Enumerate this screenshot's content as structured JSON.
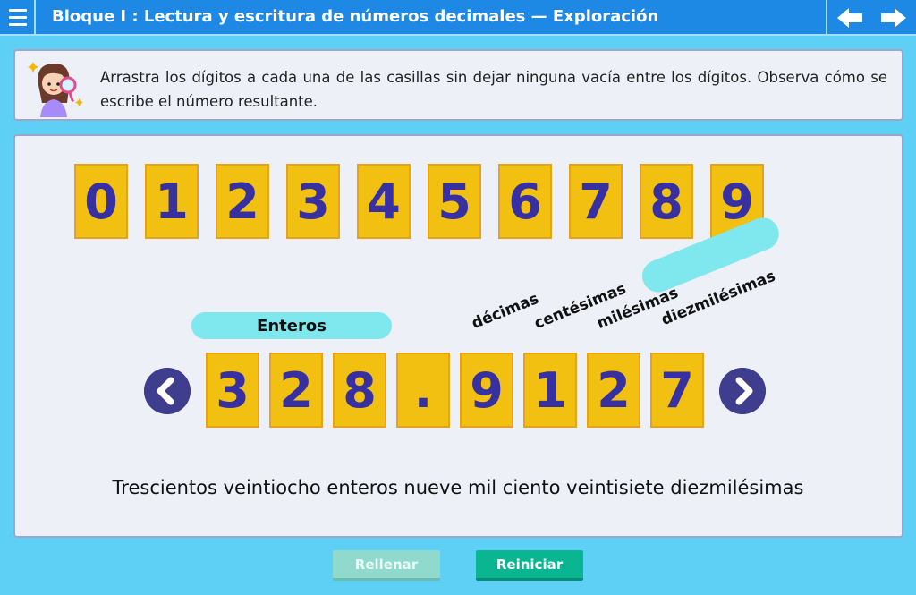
{
  "header": {
    "title": "Bloque I : Lectura y escritura de números decimales  —  Exploración"
  },
  "instructions": {
    "text": "Arrastra los dígitos a cada una de las casillas sin dejar ninguna vacía entre los dígitos. Observa cómo se escribe el número resultante."
  },
  "digits": [
    "0",
    "1",
    "2",
    "3",
    "4",
    "5",
    "6",
    "7",
    "8",
    "9"
  ],
  "number": {
    "integer_label": "Enteros",
    "slots": [
      "3",
      "2",
      "8",
      ".",
      "9",
      "1",
      "2",
      "7"
    ],
    "place_labels": [
      "décimas",
      "centésimas",
      "milésimas",
      "diezmilésimas"
    ],
    "reading": "Trescientos veintiocho enteros nueve mil ciento veintisiete diezmilésimas"
  },
  "buttons": {
    "fill_label": "Rellenar",
    "reset_label": "Reiniciar"
  },
  "colors": {
    "header": "#1e88e5",
    "background": "#5fd0f5",
    "tile": "#f2c011",
    "digit_text": "#3730a3",
    "pill": "#7ee8ee",
    "reset_button": "#0ab592"
  }
}
